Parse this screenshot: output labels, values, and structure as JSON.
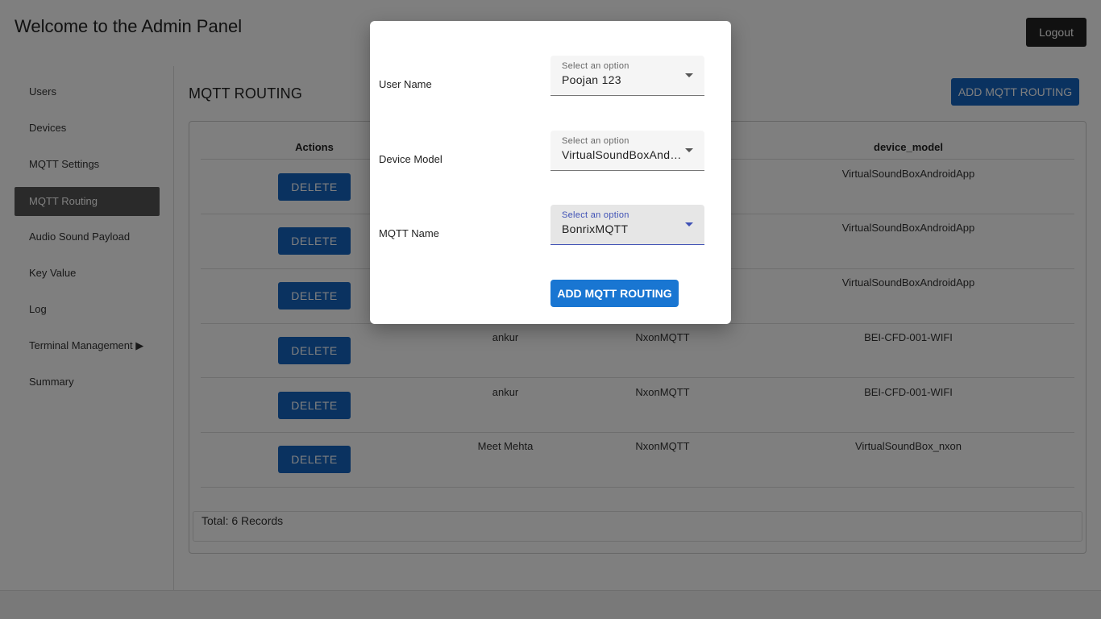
{
  "header": {
    "title": "Welcome to the Admin Panel",
    "logout_label": "Logout"
  },
  "sidebar": {
    "items": [
      {
        "label": "Users"
      },
      {
        "label": "Devices"
      },
      {
        "label": "MQTT Settings"
      },
      {
        "label": "MQTT Routing"
      },
      {
        "label": "Audio Sound Payload"
      },
      {
        "label": "Key Value"
      },
      {
        "label": "Log"
      },
      {
        "label": "Terminal Management ▶"
      },
      {
        "label": "Summary"
      }
    ],
    "active_index": 3
  },
  "main": {
    "title": "MQTT ROUTING",
    "add_button_label": "ADD MQTT ROUTING",
    "table": {
      "columns": [
        "Actions",
        "",
        "",
        "device_model"
      ],
      "delete_label": "DELETE",
      "rows": [
        {
          "user": "",
          "mqtt": "",
          "device_model": "VirtualSoundBoxAndroidApp"
        },
        {
          "user": "",
          "mqtt": "",
          "device_model": "VirtualSoundBoxAndroidApp"
        },
        {
          "user": "",
          "mqtt": "",
          "device_model": "VirtualSoundBoxAndroidApp"
        },
        {
          "user": "ankur",
          "mqtt": "NxonMQTT",
          "device_model": "BEI-CFD-001-WIFI"
        },
        {
          "user": "ankur",
          "mqtt": "NxonMQTT",
          "device_model": "BEI-CFD-001-WIFI"
        },
        {
          "user": "Meet Mehta",
          "mqtt": "NxonMQTT",
          "device_model": "VirtualSoundBox_nxon"
        }
      ],
      "total_text": "Total: 6 Records"
    }
  },
  "modal": {
    "fields": [
      {
        "label": "User Name",
        "caption": "Select an option",
        "value": "Poojan 123"
      },
      {
        "label": "Device Model",
        "caption": "Select an option",
        "value": "VirtualSoundBoxAndroidApp"
      },
      {
        "label": "MQTT Name",
        "caption": "Select an option",
        "value": "BonrixMQTT"
      }
    ],
    "submit_label": "ADD MQTT ROUTING"
  }
}
